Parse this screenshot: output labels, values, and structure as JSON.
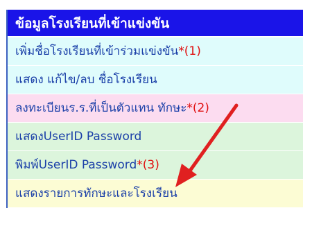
{
  "menu": {
    "header": "ข้อมูลโรงเรียนที่เข้าแข่งขัน",
    "items": [
      {
        "label": "เพิ่มชื่อโรงเรียนที่เข้าร่วมแข่งขัน",
        "marker": "*(1)",
        "bg": "#dffcfc"
      },
      {
        "label": "แสดง แก้ไข/ลบ ชื่อโรงเรียน",
        "marker": "",
        "bg": "#dffcfc"
      },
      {
        "label": "ลงทะเบียนร.ร.ที่เป็นตัวแทน ทักษะ",
        "marker": "*(2)",
        "bg": "#fcdcf0"
      },
      {
        "label": "แสดงUserID Password",
        "marker": "",
        "bg": "#dcf5dc"
      },
      {
        "label": "พิมพ์UserID Password",
        "marker": "*(3)",
        "bg": "#dcf5dc"
      },
      {
        "label": "แสดงรายการทักษะและโรงเรียน",
        "marker": "",
        "bg": "#fcfcd4"
      }
    ]
  },
  "colors": {
    "header_bg": "#1a14e8",
    "item_text": "#1a3fa8",
    "marker_text": "#e01010",
    "arrow": "#e02020"
  },
  "annotation": {
    "icon": "red-arrow-icon"
  }
}
